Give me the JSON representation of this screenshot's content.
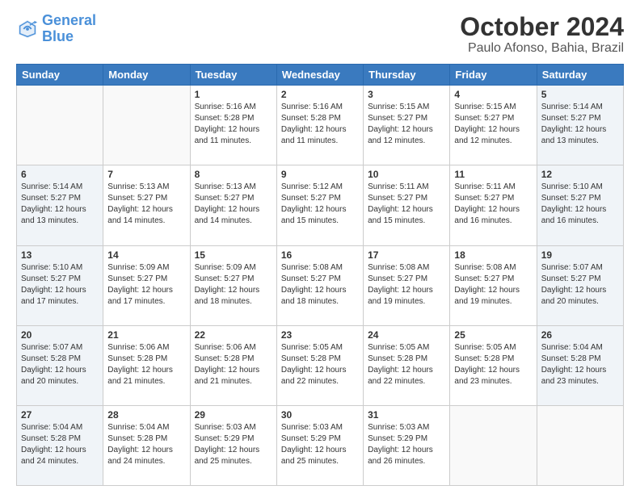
{
  "header": {
    "logo_line1": "General",
    "logo_line2": "Blue",
    "main_title": "October 2024",
    "subtitle": "Paulo Afonso, Bahia, Brazil"
  },
  "weekdays": [
    "Sunday",
    "Monday",
    "Tuesday",
    "Wednesday",
    "Thursday",
    "Friday",
    "Saturday"
  ],
  "weeks": [
    [
      {
        "day": "",
        "info": ""
      },
      {
        "day": "",
        "info": ""
      },
      {
        "day": "1",
        "info": "Sunrise: 5:16 AM\nSunset: 5:28 PM\nDaylight: 12 hours\nand 11 minutes."
      },
      {
        "day": "2",
        "info": "Sunrise: 5:16 AM\nSunset: 5:28 PM\nDaylight: 12 hours\nand 11 minutes."
      },
      {
        "day": "3",
        "info": "Sunrise: 5:15 AM\nSunset: 5:27 PM\nDaylight: 12 hours\nand 12 minutes."
      },
      {
        "day": "4",
        "info": "Sunrise: 5:15 AM\nSunset: 5:27 PM\nDaylight: 12 hours\nand 12 minutes."
      },
      {
        "day": "5",
        "info": "Sunrise: 5:14 AM\nSunset: 5:27 PM\nDaylight: 12 hours\nand 13 minutes."
      }
    ],
    [
      {
        "day": "6",
        "info": "Sunrise: 5:14 AM\nSunset: 5:27 PM\nDaylight: 12 hours\nand 13 minutes."
      },
      {
        "day": "7",
        "info": "Sunrise: 5:13 AM\nSunset: 5:27 PM\nDaylight: 12 hours\nand 14 minutes."
      },
      {
        "day": "8",
        "info": "Sunrise: 5:13 AM\nSunset: 5:27 PM\nDaylight: 12 hours\nand 14 minutes."
      },
      {
        "day": "9",
        "info": "Sunrise: 5:12 AM\nSunset: 5:27 PM\nDaylight: 12 hours\nand 15 minutes."
      },
      {
        "day": "10",
        "info": "Sunrise: 5:11 AM\nSunset: 5:27 PM\nDaylight: 12 hours\nand 15 minutes."
      },
      {
        "day": "11",
        "info": "Sunrise: 5:11 AM\nSunset: 5:27 PM\nDaylight: 12 hours\nand 16 minutes."
      },
      {
        "day": "12",
        "info": "Sunrise: 5:10 AM\nSunset: 5:27 PM\nDaylight: 12 hours\nand 16 minutes."
      }
    ],
    [
      {
        "day": "13",
        "info": "Sunrise: 5:10 AM\nSunset: 5:27 PM\nDaylight: 12 hours\nand 17 minutes."
      },
      {
        "day": "14",
        "info": "Sunrise: 5:09 AM\nSunset: 5:27 PM\nDaylight: 12 hours\nand 17 minutes."
      },
      {
        "day": "15",
        "info": "Sunrise: 5:09 AM\nSunset: 5:27 PM\nDaylight: 12 hours\nand 18 minutes."
      },
      {
        "day": "16",
        "info": "Sunrise: 5:08 AM\nSunset: 5:27 PM\nDaylight: 12 hours\nand 18 minutes."
      },
      {
        "day": "17",
        "info": "Sunrise: 5:08 AM\nSunset: 5:27 PM\nDaylight: 12 hours\nand 19 minutes."
      },
      {
        "day": "18",
        "info": "Sunrise: 5:08 AM\nSunset: 5:27 PM\nDaylight: 12 hours\nand 19 minutes."
      },
      {
        "day": "19",
        "info": "Sunrise: 5:07 AM\nSunset: 5:27 PM\nDaylight: 12 hours\nand 20 minutes."
      }
    ],
    [
      {
        "day": "20",
        "info": "Sunrise: 5:07 AM\nSunset: 5:28 PM\nDaylight: 12 hours\nand 20 minutes."
      },
      {
        "day": "21",
        "info": "Sunrise: 5:06 AM\nSunset: 5:28 PM\nDaylight: 12 hours\nand 21 minutes."
      },
      {
        "day": "22",
        "info": "Sunrise: 5:06 AM\nSunset: 5:28 PM\nDaylight: 12 hours\nand 21 minutes."
      },
      {
        "day": "23",
        "info": "Sunrise: 5:05 AM\nSunset: 5:28 PM\nDaylight: 12 hours\nand 22 minutes."
      },
      {
        "day": "24",
        "info": "Sunrise: 5:05 AM\nSunset: 5:28 PM\nDaylight: 12 hours\nand 22 minutes."
      },
      {
        "day": "25",
        "info": "Sunrise: 5:05 AM\nSunset: 5:28 PM\nDaylight: 12 hours\nand 23 minutes."
      },
      {
        "day": "26",
        "info": "Sunrise: 5:04 AM\nSunset: 5:28 PM\nDaylight: 12 hours\nand 23 minutes."
      }
    ],
    [
      {
        "day": "27",
        "info": "Sunrise: 5:04 AM\nSunset: 5:28 PM\nDaylight: 12 hours\nand 24 minutes."
      },
      {
        "day": "28",
        "info": "Sunrise: 5:04 AM\nSunset: 5:28 PM\nDaylight: 12 hours\nand 24 minutes."
      },
      {
        "day": "29",
        "info": "Sunrise: 5:03 AM\nSunset: 5:29 PM\nDaylight: 12 hours\nand 25 minutes."
      },
      {
        "day": "30",
        "info": "Sunrise: 5:03 AM\nSunset: 5:29 PM\nDaylight: 12 hours\nand 25 minutes."
      },
      {
        "day": "31",
        "info": "Sunrise: 5:03 AM\nSunset: 5:29 PM\nDaylight: 12 hours\nand 26 minutes."
      },
      {
        "day": "",
        "info": ""
      },
      {
        "day": "",
        "info": ""
      }
    ]
  ]
}
